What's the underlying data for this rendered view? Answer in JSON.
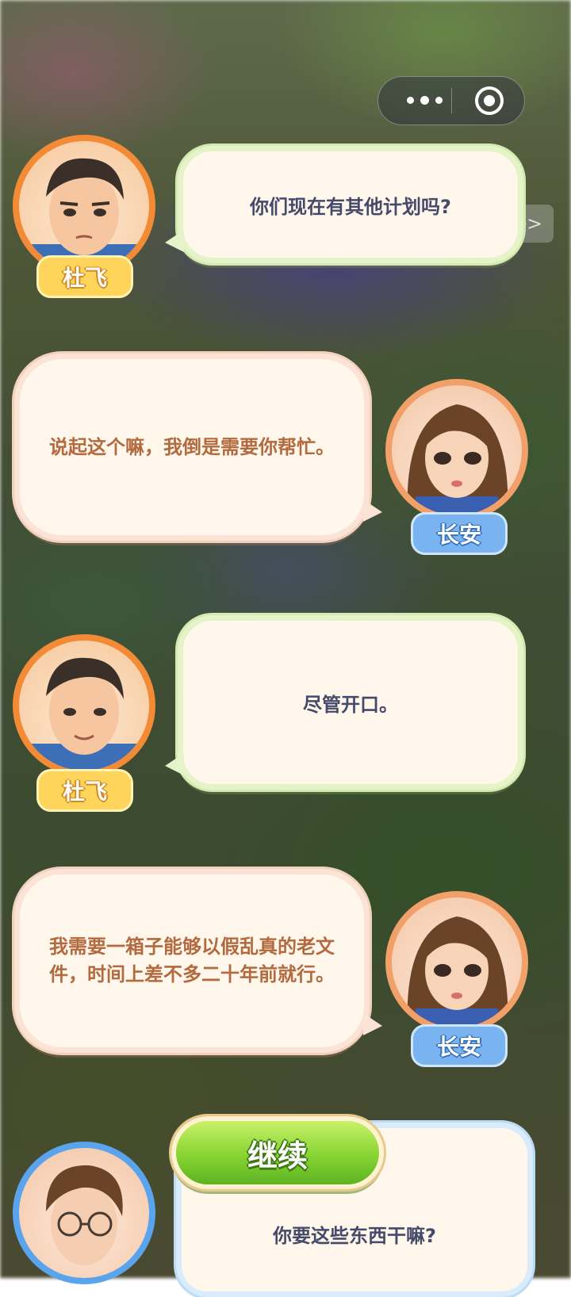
{
  "miniapp_capsule": {
    "more_icon": "more-dots-icon",
    "close_icon": "target-circle-icon"
  },
  "skip_button": {
    "label": ">>"
  },
  "dialog": [
    {
      "speaker": "杜飞",
      "side": "left",
      "text": "你们现在有其他计划吗?",
      "tag_color": "#ffd45a"
    },
    {
      "speaker": "长安",
      "side": "right",
      "text": "说起这个嘛，我倒是需要你帮忙。",
      "tag_color": "#79b4f0"
    },
    {
      "speaker": "杜飞",
      "side": "left",
      "text": "尽管开口。",
      "tag_color": "#ffd45a"
    },
    {
      "speaker": "长安",
      "side": "right",
      "text": "我需要一箱子能够以假乱真的老文件，时间上差不多二十年前就行。",
      "tag_color": "#79b4f0"
    }
  ],
  "current": {
    "text": "你要这些东西干嘛?",
    "continue_label": "继续"
  }
}
